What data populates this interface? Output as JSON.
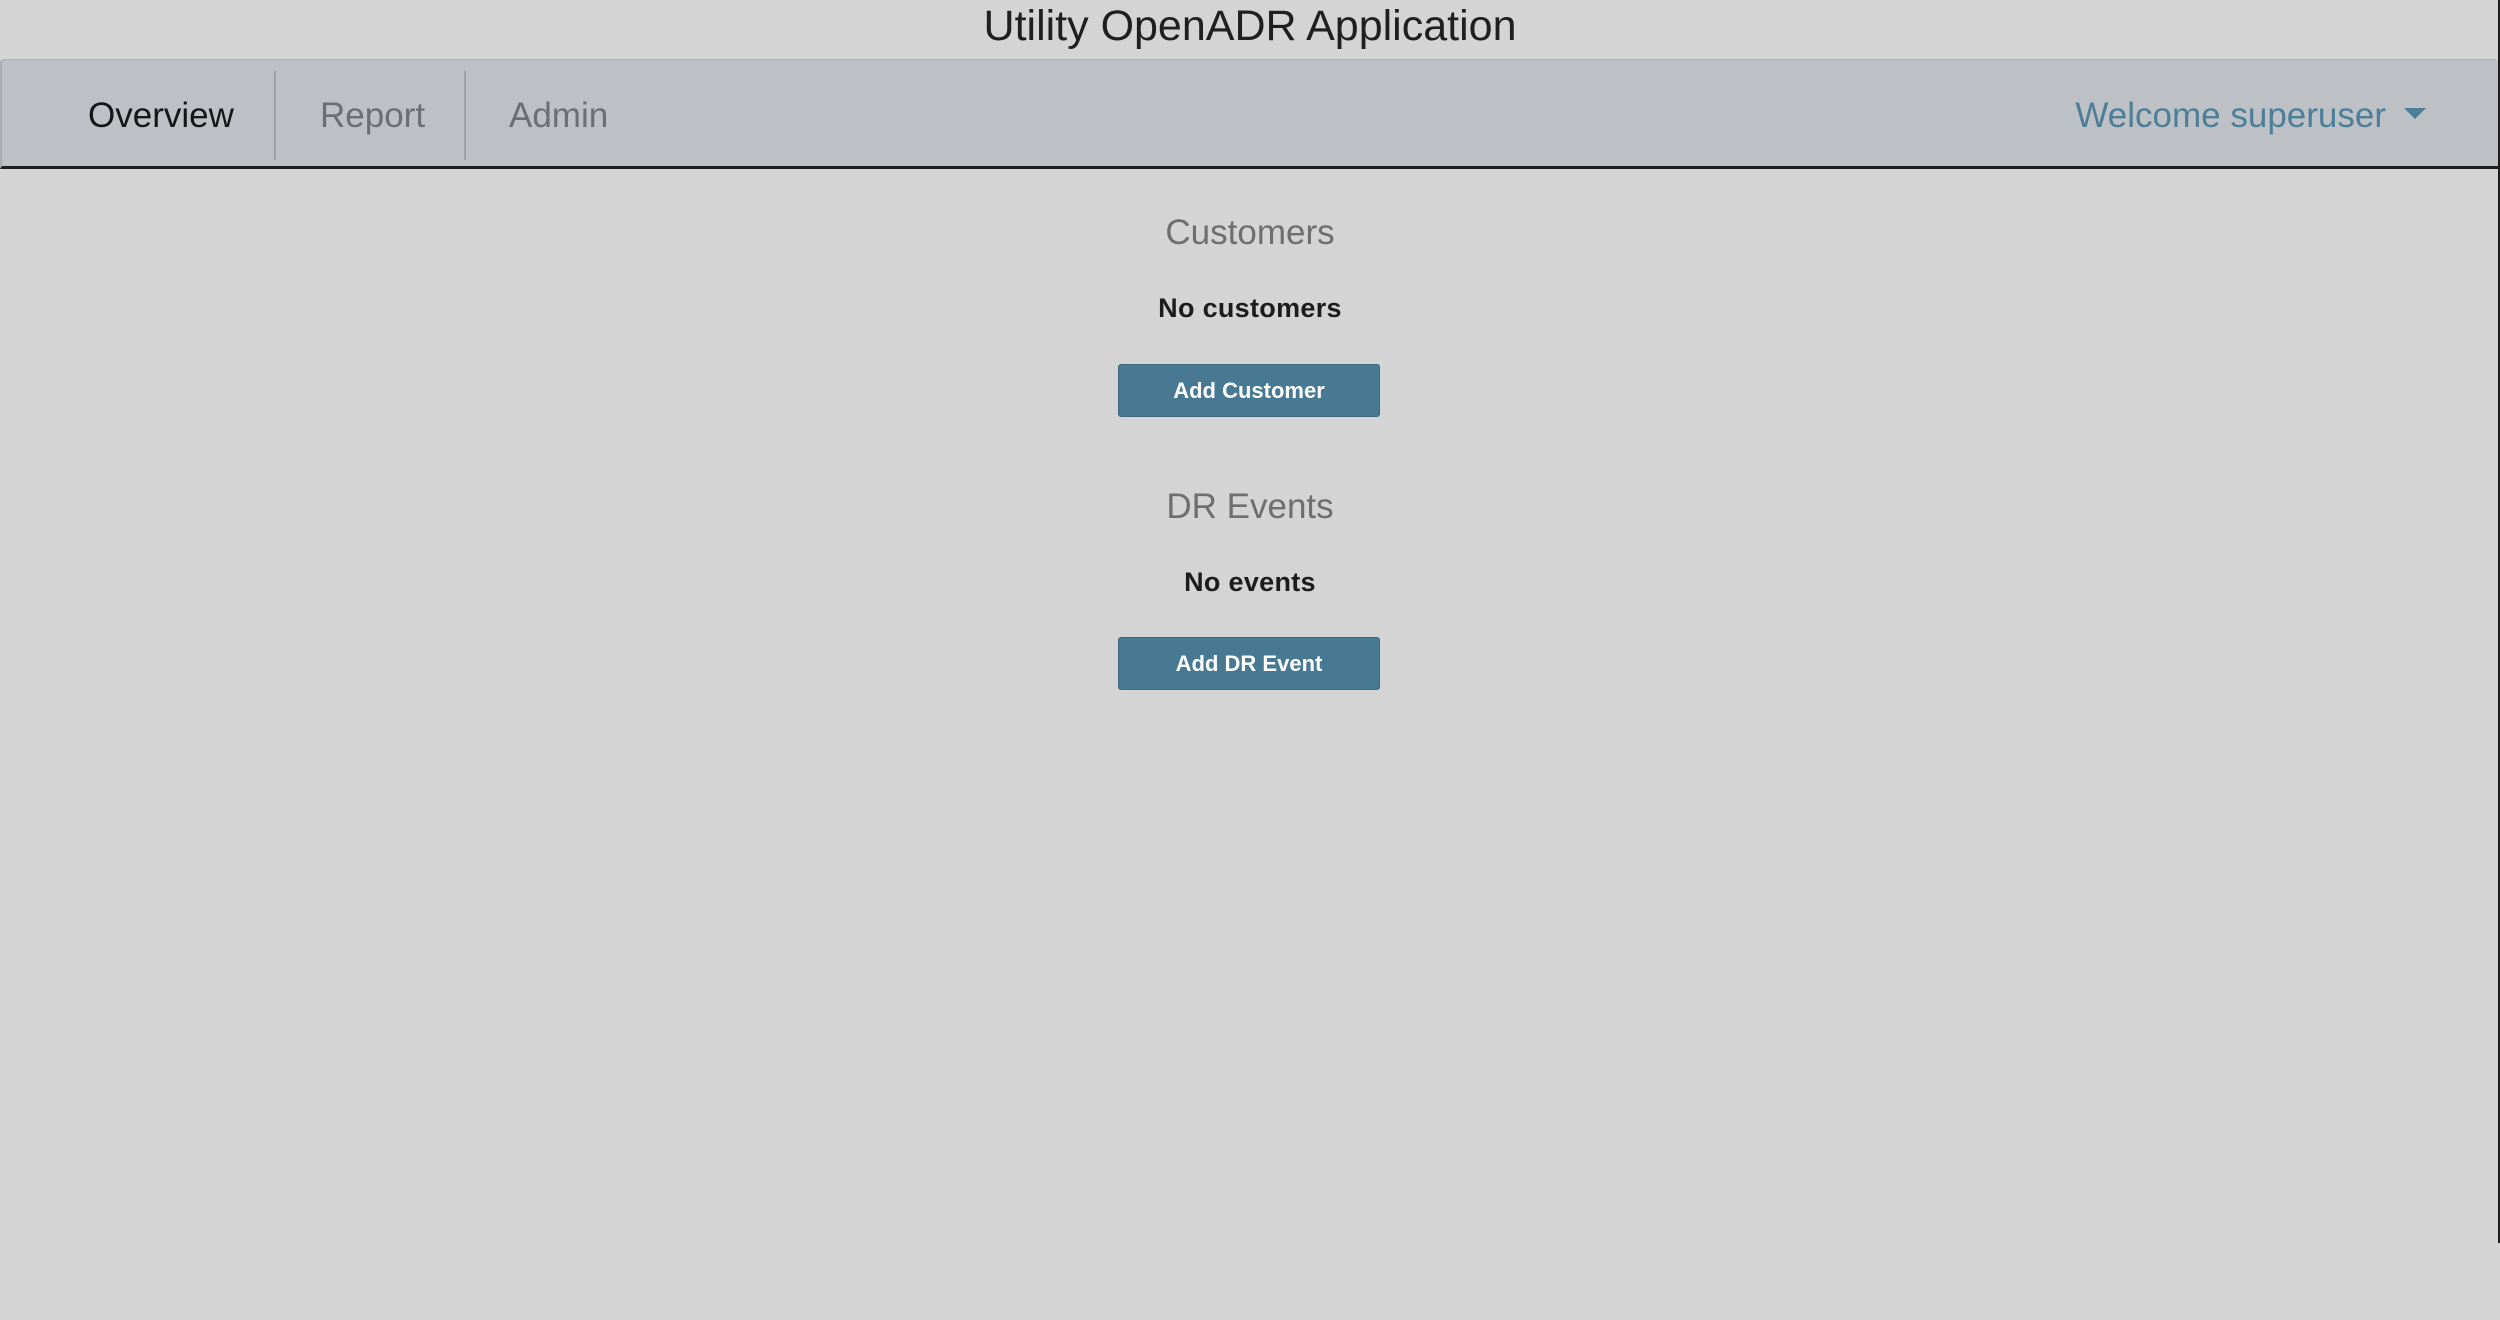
{
  "app": {
    "title": "Utility OpenADR Application"
  },
  "nav": {
    "tabs": [
      {
        "label": "Overview",
        "active": true
      },
      {
        "label": "Report",
        "active": false
      },
      {
        "label": "Admin",
        "active": false
      }
    ],
    "user_menu_label": "Welcome superuser"
  },
  "customers": {
    "heading": "Customers",
    "empty_text": "No customers",
    "add_button_label": "Add Customer"
  },
  "events": {
    "heading": "DR Events",
    "empty_text": "No events",
    "add_button_label": "Add DR Event"
  },
  "colors": {
    "background": "#d4d4d4",
    "navbar": "#bdc1c6",
    "accent": "#477992",
    "link": "#4d7e98"
  }
}
